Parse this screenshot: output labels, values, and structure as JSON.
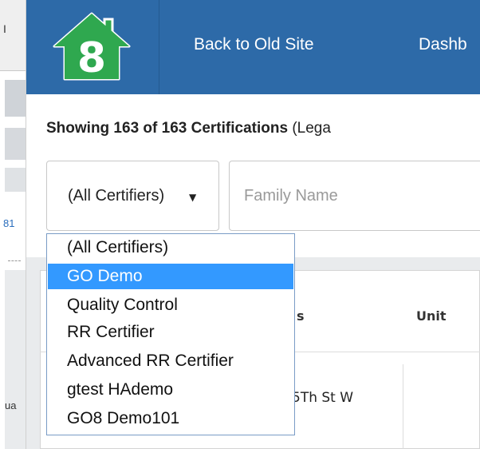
{
  "left_strip": {
    "tab_glyph": "I",
    "blue_fragment": "81",
    "lower_fragment": "ua"
  },
  "navbar": {
    "logo_text": "8",
    "links": [
      {
        "label": "Back to Old Site"
      },
      {
        "label": "Dashb"
      }
    ]
  },
  "heading": {
    "bold_text": "Showing 163 of 163 Certifications",
    "suffix_text": "(Lega"
  },
  "filters": {
    "certifier_select": {
      "selected_value": "(All Certifiers)",
      "arrow_icon": "triangle-down"
    },
    "family_name_placeholder": "Family Name"
  },
  "dropdown": {
    "options": [
      {
        "label": "(All Certifiers)"
      },
      {
        "label": "GO Demo"
      },
      {
        "label": "Quality Control"
      },
      {
        "label": "RR Certifier"
      },
      {
        "label": "Advanced RR Certifier"
      },
      {
        "label": "gtest HAdemo"
      },
      {
        "label": "GO8 Demo101"
      }
    ],
    "highlighted_index": 1
  },
  "table": {
    "headers": [
      "s",
      "Unit"
    ],
    "rows": [
      {
        "address_fragment": "5Th St W"
      }
    ]
  },
  "colors": {
    "navbar": "#2d6aa8",
    "logo_green": "#2fa84f",
    "selection": "#3399ff"
  }
}
